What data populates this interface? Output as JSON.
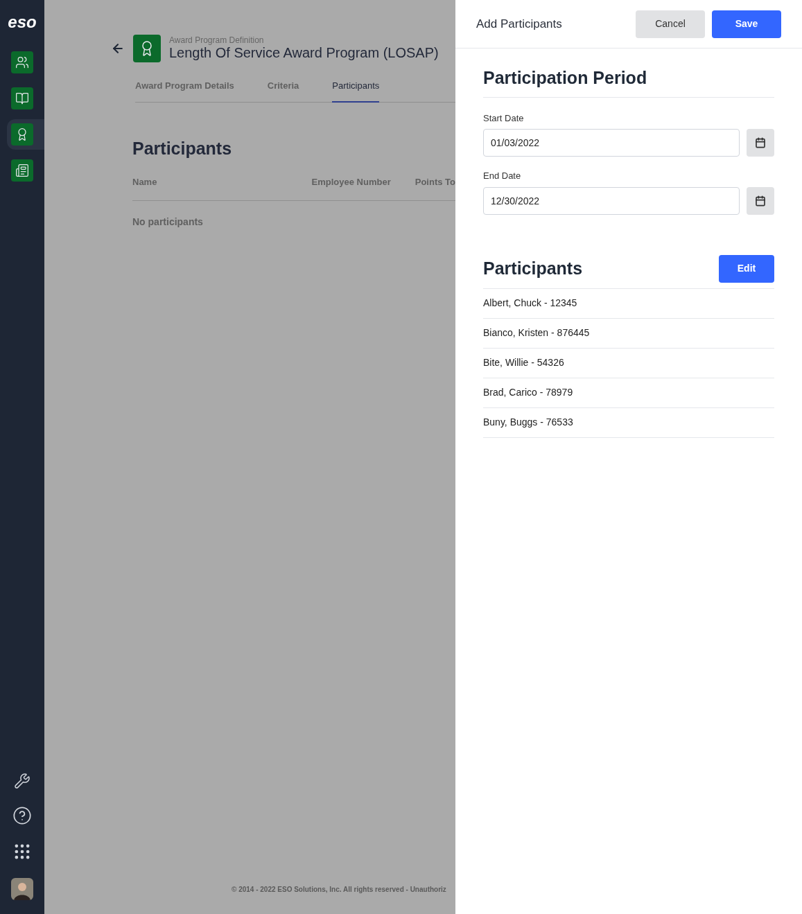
{
  "sidebar": {
    "logo": "eso",
    "nav": [
      {
        "selected": false
      },
      {
        "selected": false
      },
      {
        "selected": true
      },
      {
        "selected": false
      }
    ]
  },
  "page": {
    "subtitle": "Award Program Definition",
    "title": "Length Of Service Award Program (LOSAP)",
    "tabs": [
      {
        "label": "Award Program Details",
        "selected": false
      },
      {
        "label": "Criteria",
        "selected": false
      },
      {
        "label": "Participants",
        "selected": true
      }
    ],
    "section_title": "Participants",
    "columns": [
      "Name",
      "Employee Number",
      "Points To"
    ],
    "empty_text": "No participants",
    "footer": "© 2014 - 2022 ESO Solutions, Inc. All rights reserved - Unauthoriz"
  },
  "drawer": {
    "title": "Add Participants",
    "cancel": "Cancel",
    "save": "Save",
    "period_title": "Participation Period",
    "fields": [
      {
        "label": "Start Date",
        "value": "01/03/2022"
      },
      {
        "label": "End Date",
        "value": "12/30/2022"
      }
    ],
    "participants_title": "Participants",
    "edit": "Edit",
    "participants": [
      "Albert, Chuck - 12345",
      "Bianco, Kristen - 876445",
      "Bite, Willie - 54326",
      "Brad, Carico - 78979",
      "Buny, Buggs - 76533"
    ]
  }
}
